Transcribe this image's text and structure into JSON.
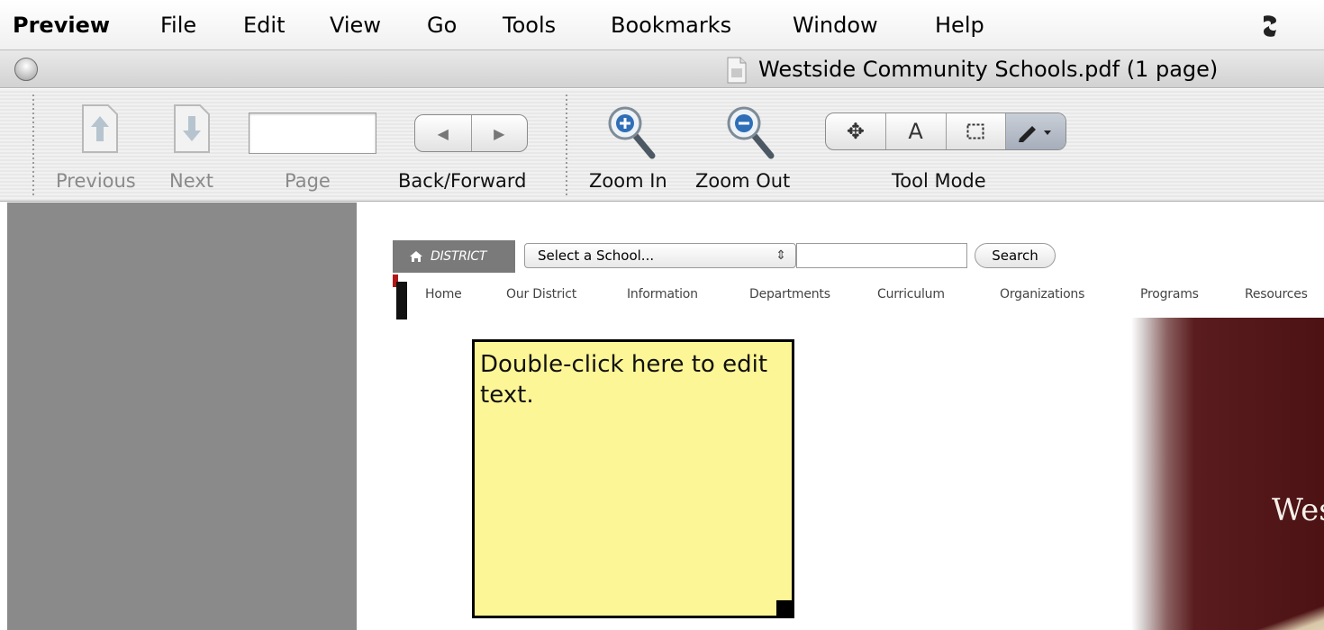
{
  "menubar": {
    "app_name": "Preview",
    "items": [
      "File",
      "Edit",
      "View",
      "Go",
      "Tools",
      "Bookmarks",
      "Window",
      "Help"
    ]
  },
  "window": {
    "title": "Westside Community Schools.pdf (1 page)"
  },
  "toolbar": {
    "previous_label": "Previous",
    "next_label": "Next",
    "page_label": "Page",
    "page_value": "",
    "back_forward_label": "Back/Forward",
    "zoom_in_label": "Zoom In",
    "zoom_out_label": "Zoom Out",
    "tool_mode_label": "Tool Mode",
    "tool_text_glyph": "A"
  },
  "pdf": {
    "district_tab": "DISTRICT",
    "school_select": "Select a School...",
    "search_button": "Search",
    "nav": [
      "Home",
      "Our District",
      "Information",
      "Departments",
      "Curriculum",
      "Organizations",
      "Programs",
      "Resources"
    ],
    "banner_text": "Wes"
  },
  "note": {
    "text": "Double-click here to edit text."
  },
  "colors": {
    "note_background": "#fdf696",
    "sidebar": "#8a8a8a",
    "banner": "#4c1214"
  }
}
